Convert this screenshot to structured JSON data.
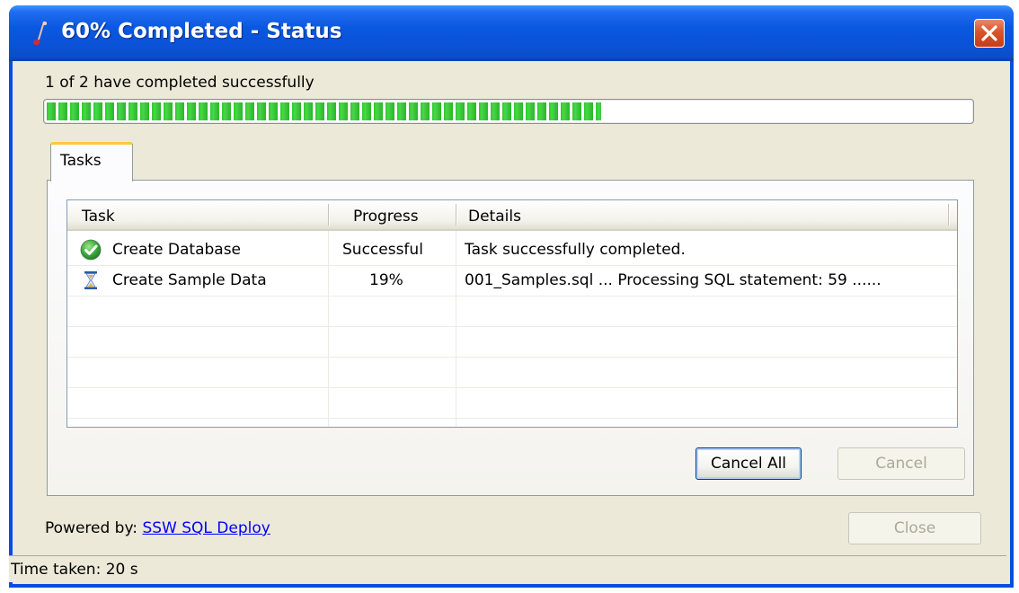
{
  "window": {
    "title": "60% Completed - Status",
    "close_icon": "close-icon"
  },
  "status": {
    "message": "1 of 2 have completed successfully",
    "progress_percent": 60
  },
  "tabs": [
    {
      "label": "Tasks",
      "active": true
    }
  ],
  "table": {
    "columns": [
      "Task",
      "Progress",
      "Details"
    ],
    "rows": [
      {
        "icon": "check-circle-icon",
        "task": "Create Database",
        "progress": "Successful",
        "details": "Task successfully completed."
      },
      {
        "icon": "hourglass-icon",
        "task": "Create Sample Data",
        "progress": "19%",
        "details": "001_Samples.sql ... Processing SQL statement: 59 ......"
      }
    ]
  },
  "buttons": {
    "cancel_all": "Cancel All",
    "cancel": "Cancel",
    "close": "Close"
  },
  "footer": {
    "powered_label": "Powered by:",
    "powered_link": "SSW SQL Deploy"
  },
  "statusbar": {
    "time_taken": "Time taken: 20 s"
  },
  "colors": {
    "titlebar": "#0a58e0",
    "progress": "#2ec82e",
    "link": "#0000ff",
    "dialog_bg": "#ece9d8"
  }
}
